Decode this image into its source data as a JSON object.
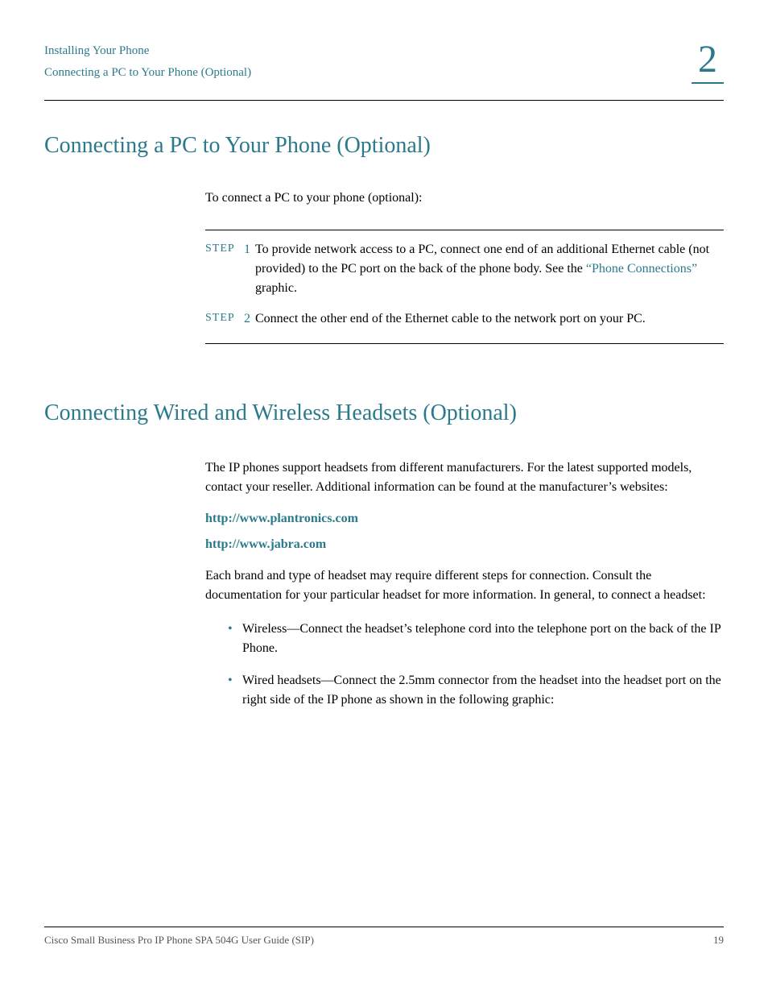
{
  "header": {
    "breadcrumb_top": "Installing Your Phone",
    "breadcrumb_sub": "Connecting a PC to Your Phone (Optional)",
    "chapter_number": "2"
  },
  "section1": {
    "heading": "Connecting a PC to Your Phone (Optional)",
    "intro": "To connect a PC to your phone (optional):",
    "steps": [
      {
        "label": "STEP",
        "num": "1",
        "text_before": "To provide network access to a PC, connect one end of an additional Ethernet cable (not provided) to the PC port on the back of the phone body. See the ",
        "link": "“Phone Connections”",
        "text_after": " graphic."
      },
      {
        "label": "STEP",
        "num": "2",
        "text_before": "Connect the other end of the Ethernet cable to the network port on your PC.",
        "link": "",
        "text_after": ""
      }
    ]
  },
  "section2": {
    "heading": "Connecting Wired and Wireless Headsets (Optional)",
    "para1": "The IP phones support headsets from different manufacturers. For the latest supported models, contact your reseller. Additional information can be found at the manufacturer’s websites:",
    "url1": "http://www.plantronics.com",
    "url2": "http://www.jabra.com",
    "para2": "Each brand and type of headset may require different steps for connection. Consult the documentation for your particular headset for more information. In general, to connect a headset:",
    "bullets": [
      "Wireless—Connect the headset’s telephone cord into the telephone port on the back of the IP Phone.",
      "Wired headsets—Connect the 2.5mm connector from the headset into the headset port on the right side of the IP phone as shown in the following graphic:"
    ]
  },
  "footer": {
    "title": "Cisco Small Business Pro IP Phone SPA 504G User Guide (SIP)",
    "page": "19"
  }
}
